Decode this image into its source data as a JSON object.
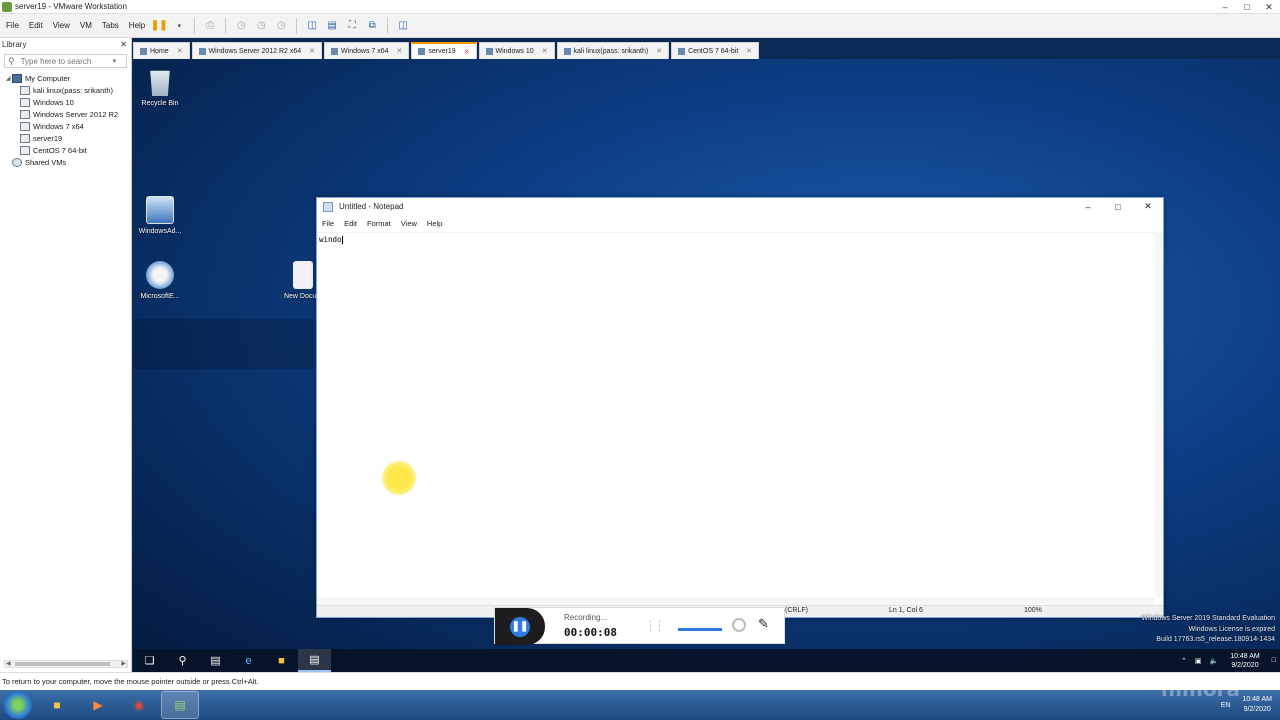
{
  "vmware": {
    "title": "server19 - VMware Workstation",
    "menu": [
      "File",
      "Edit",
      "View",
      "VM",
      "Tabs",
      "Help"
    ],
    "library": {
      "header": "Library",
      "search_placeholder": "Type here to search",
      "tree": [
        {
          "label": "My Computer",
          "level": 0,
          "icon": "computer-icon"
        },
        {
          "label": "kali linux(pass: srikanth)",
          "level": 1,
          "icon": "vm-icon"
        },
        {
          "label": "Windows 10",
          "level": 1,
          "icon": "vm-icon"
        },
        {
          "label": "Windows Server 2012 R2",
          "level": 1,
          "icon": "vm-icon"
        },
        {
          "label": "Windows 7 x64",
          "level": 1,
          "icon": "vm-icon"
        },
        {
          "label": "server19",
          "level": 1,
          "icon": "vm-icon"
        },
        {
          "label": "CentOS 7 64-bit",
          "level": 1,
          "icon": "vm-icon"
        },
        {
          "label": "Shared VMs",
          "level": 0,
          "icon": "shared-vms-icon"
        }
      ]
    },
    "tabs": [
      {
        "label": "Home",
        "active": false
      },
      {
        "label": "Windows Server 2012 R2 x64",
        "active": false
      },
      {
        "label": "Windows 7 x64",
        "active": false
      },
      {
        "label": "server19",
        "active": true
      },
      {
        "label": "Windows 10",
        "active": false
      },
      {
        "label": "kali linux(pass: srikanth)",
        "active": false
      },
      {
        "label": "CentOS 7 64-bit",
        "active": false
      }
    ],
    "status_text": "To return to your computer, move the mouse pointer outside or press Ctrl+Alt."
  },
  "desktop": {
    "icons": [
      {
        "label": "Recycle Bin"
      },
      {
        "label": "WindowsAd..."
      },
      {
        "label": "MicrosoftE..."
      },
      {
        "label": "New Docu..."
      }
    ],
    "watermark": [
      "Windows Server 2019 Standard Evaluation",
      "Windows License is expired",
      "Build 17763.rs5_release.180914-1434"
    ]
  },
  "notepad": {
    "title": "Untitled - Notepad",
    "menu": [
      "File",
      "Edit",
      "Format",
      "View",
      "Help"
    ],
    "content": "windo",
    "status": {
      "encoding": "(CRLF)",
      "position": "Ln 1, Col 6",
      "zoom": "100%"
    }
  },
  "recorder": {
    "state_label": "Recording...",
    "elapsed": "00:00:08"
  },
  "guest_taskbar": {
    "lang": "EN",
    "time": "10:48 AM",
    "date": "9/2/2020"
  },
  "host_taskbar": {
    "lang": "EN",
    "time": "10:48 AM",
    "date": "9/2/2020",
    "watermark": "filmora"
  },
  "colors": {
    "accent": "#f19b00",
    "desktop": "#0d3f86",
    "recorder_button": "#2f7de1"
  }
}
